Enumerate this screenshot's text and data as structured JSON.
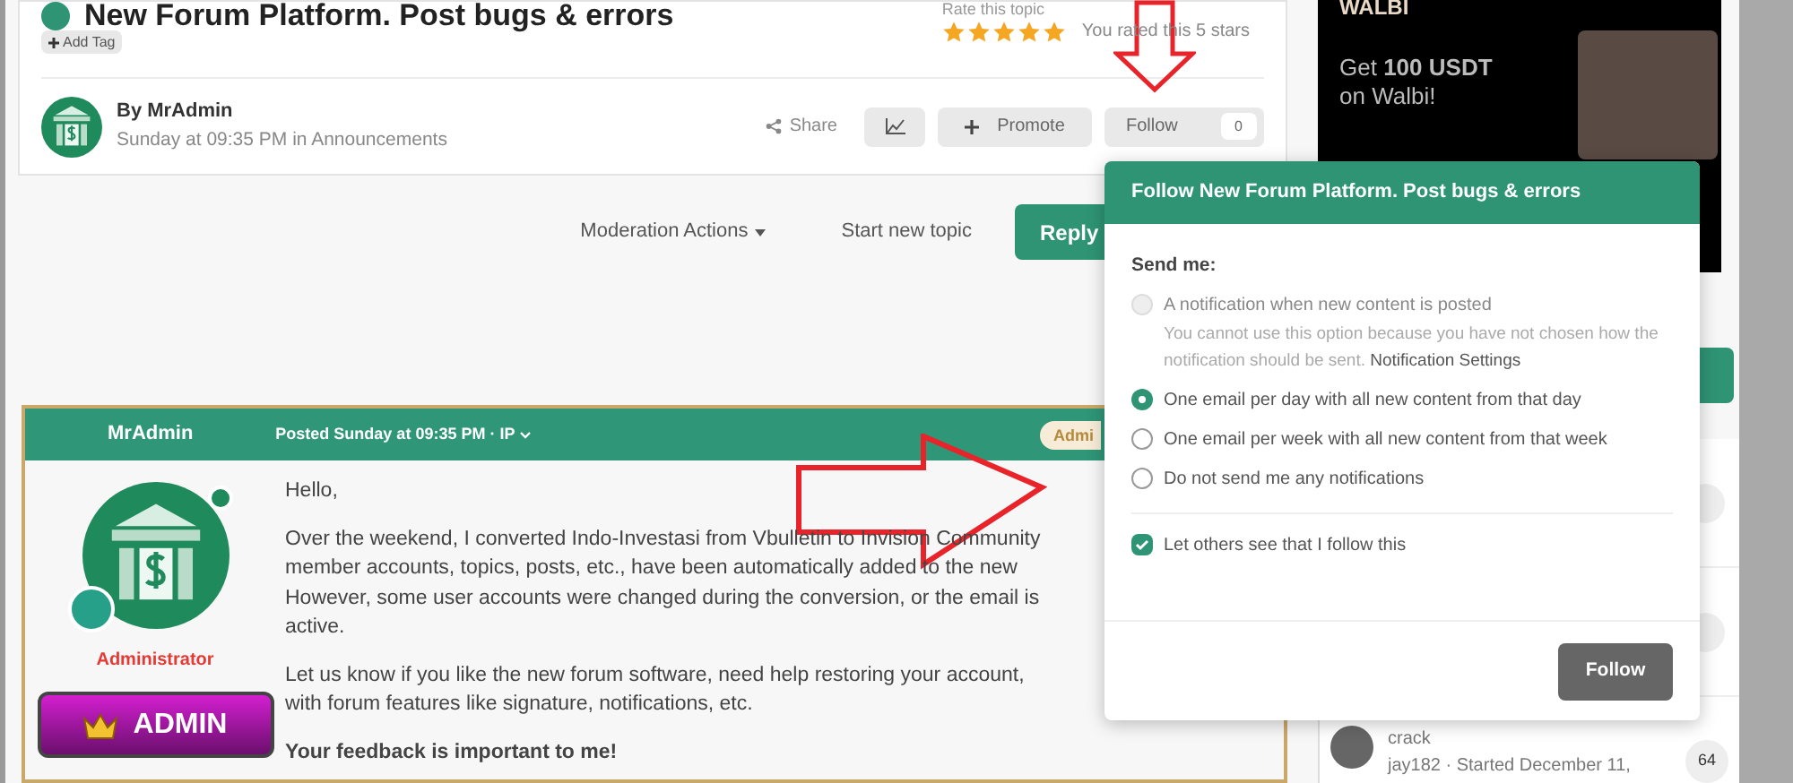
{
  "topic": {
    "title": "New Forum Platform. Post bugs & errors",
    "add_tag": "Add Tag",
    "rating": {
      "label": "Rate this topic",
      "stars": 5,
      "note": "You rated this 5 stars"
    },
    "author": {
      "by": "By MrAdmin",
      "meta": "Sunday at 09:35 PM in Announcements"
    },
    "actions": {
      "share": "Share",
      "promote": "Promote",
      "follow": "Follow",
      "follow_count": "0"
    }
  },
  "toolbar": {
    "moderation": "Moderation Actions",
    "start": "Start new topic",
    "reply": "Reply"
  },
  "post": {
    "author": "MrAdmin",
    "posted": "Posted Sunday at 09:35 PM · IP",
    "badge": "Admi",
    "role": "Administrator",
    "rank_badge": "ADMIN",
    "paragraphs": [
      {
        "bold": false,
        "lines": [
          "Hello,"
        ]
      },
      {
        "bold": false,
        "lines": [
          "Over the weekend, I converted Indo-Investasi from Vbulletin to Invision Community",
          "member accounts, topics, posts, etc., have been automatically added to the new",
          "However, some user accounts were changed during the conversion, or the email is",
          "active."
        ]
      },
      {
        "bold": false,
        "lines": [
          "Let us know if you like the new forum software, need help restoring your account,",
          "with forum features like signature, notifications, etc."
        ]
      },
      {
        "bold": true,
        "lines": [
          "Your feedback is important to me!"
        ]
      }
    ]
  },
  "sidebar": {
    "ad": {
      "brand": "WALBI",
      "headline": "Get **100 USDT**",
      "subline": "on Walbi!"
    },
    "topics": [
      {
        "title": "crack",
        "meta": "jay182 · Started December 11,",
        "count": "64"
      }
    ]
  },
  "follow_popup": {
    "title": "Follow New Forum Platform. Post bugs & errors",
    "send_label": "Send me:",
    "options": [
      {
        "label": "A notification when new content is posted",
        "selected": false,
        "disabled": true,
        "hint": "You cannot use this option because you have not chosen how the notification should be sent.",
        "hint_link": "Notification Settings"
      },
      {
        "label": "One email per day with all new content from that day",
        "selected": true,
        "disabled": false
      },
      {
        "label": "One email per week with all new content from that week",
        "selected": false,
        "disabled": false
      },
      {
        "label": "Do not send me any notifications",
        "selected": false,
        "disabled": false
      }
    ],
    "share_option": {
      "label": "Let others see that I follow this",
      "checked": true
    },
    "submit": "Follow"
  }
}
